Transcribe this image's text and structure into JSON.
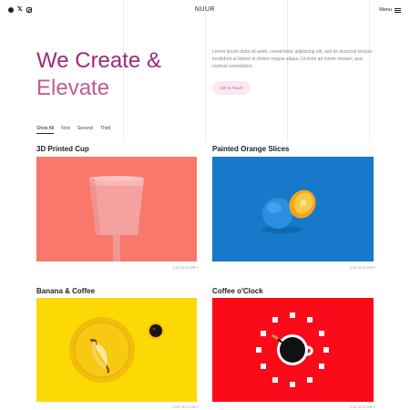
{
  "header": {
    "logo": "NUUR",
    "menu_label": "Menu",
    "social_icons": [
      "facebook-icon",
      "x-icon",
      "instagram-icon"
    ]
  },
  "hero": {
    "title_line1": "We Create &",
    "title_line2": "Elevate",
    "description": "Lorem ipsum dolor sit amet, consectetur adipiscing elit, sed do eiusmod tempor incididunt ut labore et dolore magna aliqua. Ut enim ad minim veniam, quis nostrud exercitation.",
    "cta_label": "Get in Touch"
  },
  "filters": [
    "Show All",
    "First",
    "Second",
    "Third"
  ],
  "projects": [
    {
      "title": "3D Printed Cup",
      "category": "CATEGORY",
      "bg": "#f9786b"
    },
    {
      "title": "Painted Orange Slices",
      "category": "CATEGORY",
      "bg": "#1679c9"
    },
    {
      "title": "Banana & Coffee",
      "category": "CATEGORY",
      "bg": "#fcd804"
    },
    {
      "title": "Coffee o'Clock",
      "category": "CATEGORY",
      "bg": "#fb0a1a"
    }
  ],
  "colors": {
    "accent": "#9c2a7e",
    "accent_light": "#bf5c96",
    "cta_bg": "#fbe8f1"
  }
}
